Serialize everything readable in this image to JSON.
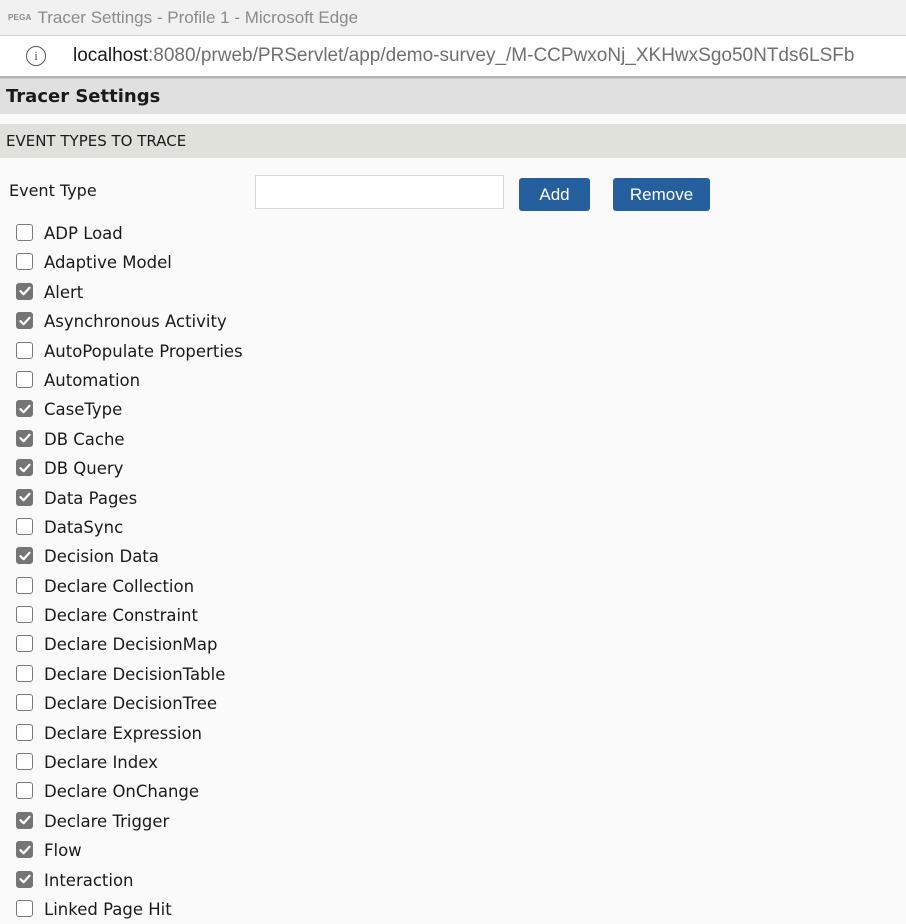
{
  "window": {
    "logo": "PEGA",
    "title": "Tracer Settings - Profile 1 - Microsoft Edge"
  },
  "addressbar": {
    "icon": "info-icon",
    "url_host": "localhost",
    "url_rest": ":8080/prweb/PRServlet/app/demo-survey_/M-CCPwxoNj_XKHwxSgo50NTds6LSFb"
  },
  "page": {
    "title": "Tracer Settings"
  },
  "section": {
    "title": "EVENT TYPES TO TRACE"
  },
  "event_type": {
    "label": "Event Type",
    "value": "",
    "placeholder": "",
    "add_label": "Add",
    "remove_label": "Remove"
  },
  "event_types": [
    {
      "label": "ADP Load",
      "checked": false
    },
    {
      "label": "Adaptive Model",
      "checked": false
    },
    {
      "label": "Alert",
      "checked": true
    },
    {
      "label": "Asynchronous Activity",
      "checked": true
    },
    {
      "label": "AutoPopulate Properties",
      "checked": false
    },
    {
      "label": "Automation",
      "checked": false
    },
    {
      "label": "CaseType",
      "checked": true
    },
    {
      "label": "DB Cache",
      "checked": true
    },
    {
      "label": "DB Query",
      "checked": true
    },
    {
      "label": "Data Pages",
      "checked": true
    },
    {
      "label": "DataSync",
      "checked": false
    },
    {
      "label": "Decision Data",
      "checked": true
    },
    {
      "label": "Declare Collection",
      "checked": false
    },
    {
      "label": "Declare Constraint",
      "checked": false
    },
    {
      "label": "Declare DecisionMap",
      "checked": false
    },
    {
      "label": "Declare DecisionTable",
      "checked": false
    },
    {
      "label": "Declare DecisionTree",
      "checked": false
    },
    {
      "label": "Declare Expression",
      "checked": false
    },
    {
      "label": "Declare Index",
      "checked": false
    },
    {
      "label": "Declare OnChange",
      "checked": false
    },
    {
      "label": "Declare Trigger",
      "checked": true
    },
    {
      "label": "Flow",
      "checked": true
    },
    {
      "label": "Interaction",
      "checked": true
    },
    {
      "label": "Linked Page Hit",
      "checked": false
    }
  ],
  "colors": {
    "button": "#265f9e",
    "checkbox_checked": "#757575",
    "section_bg": "#e1e1dc",
    "header_bg": "#e0e0e0"
  }
}
